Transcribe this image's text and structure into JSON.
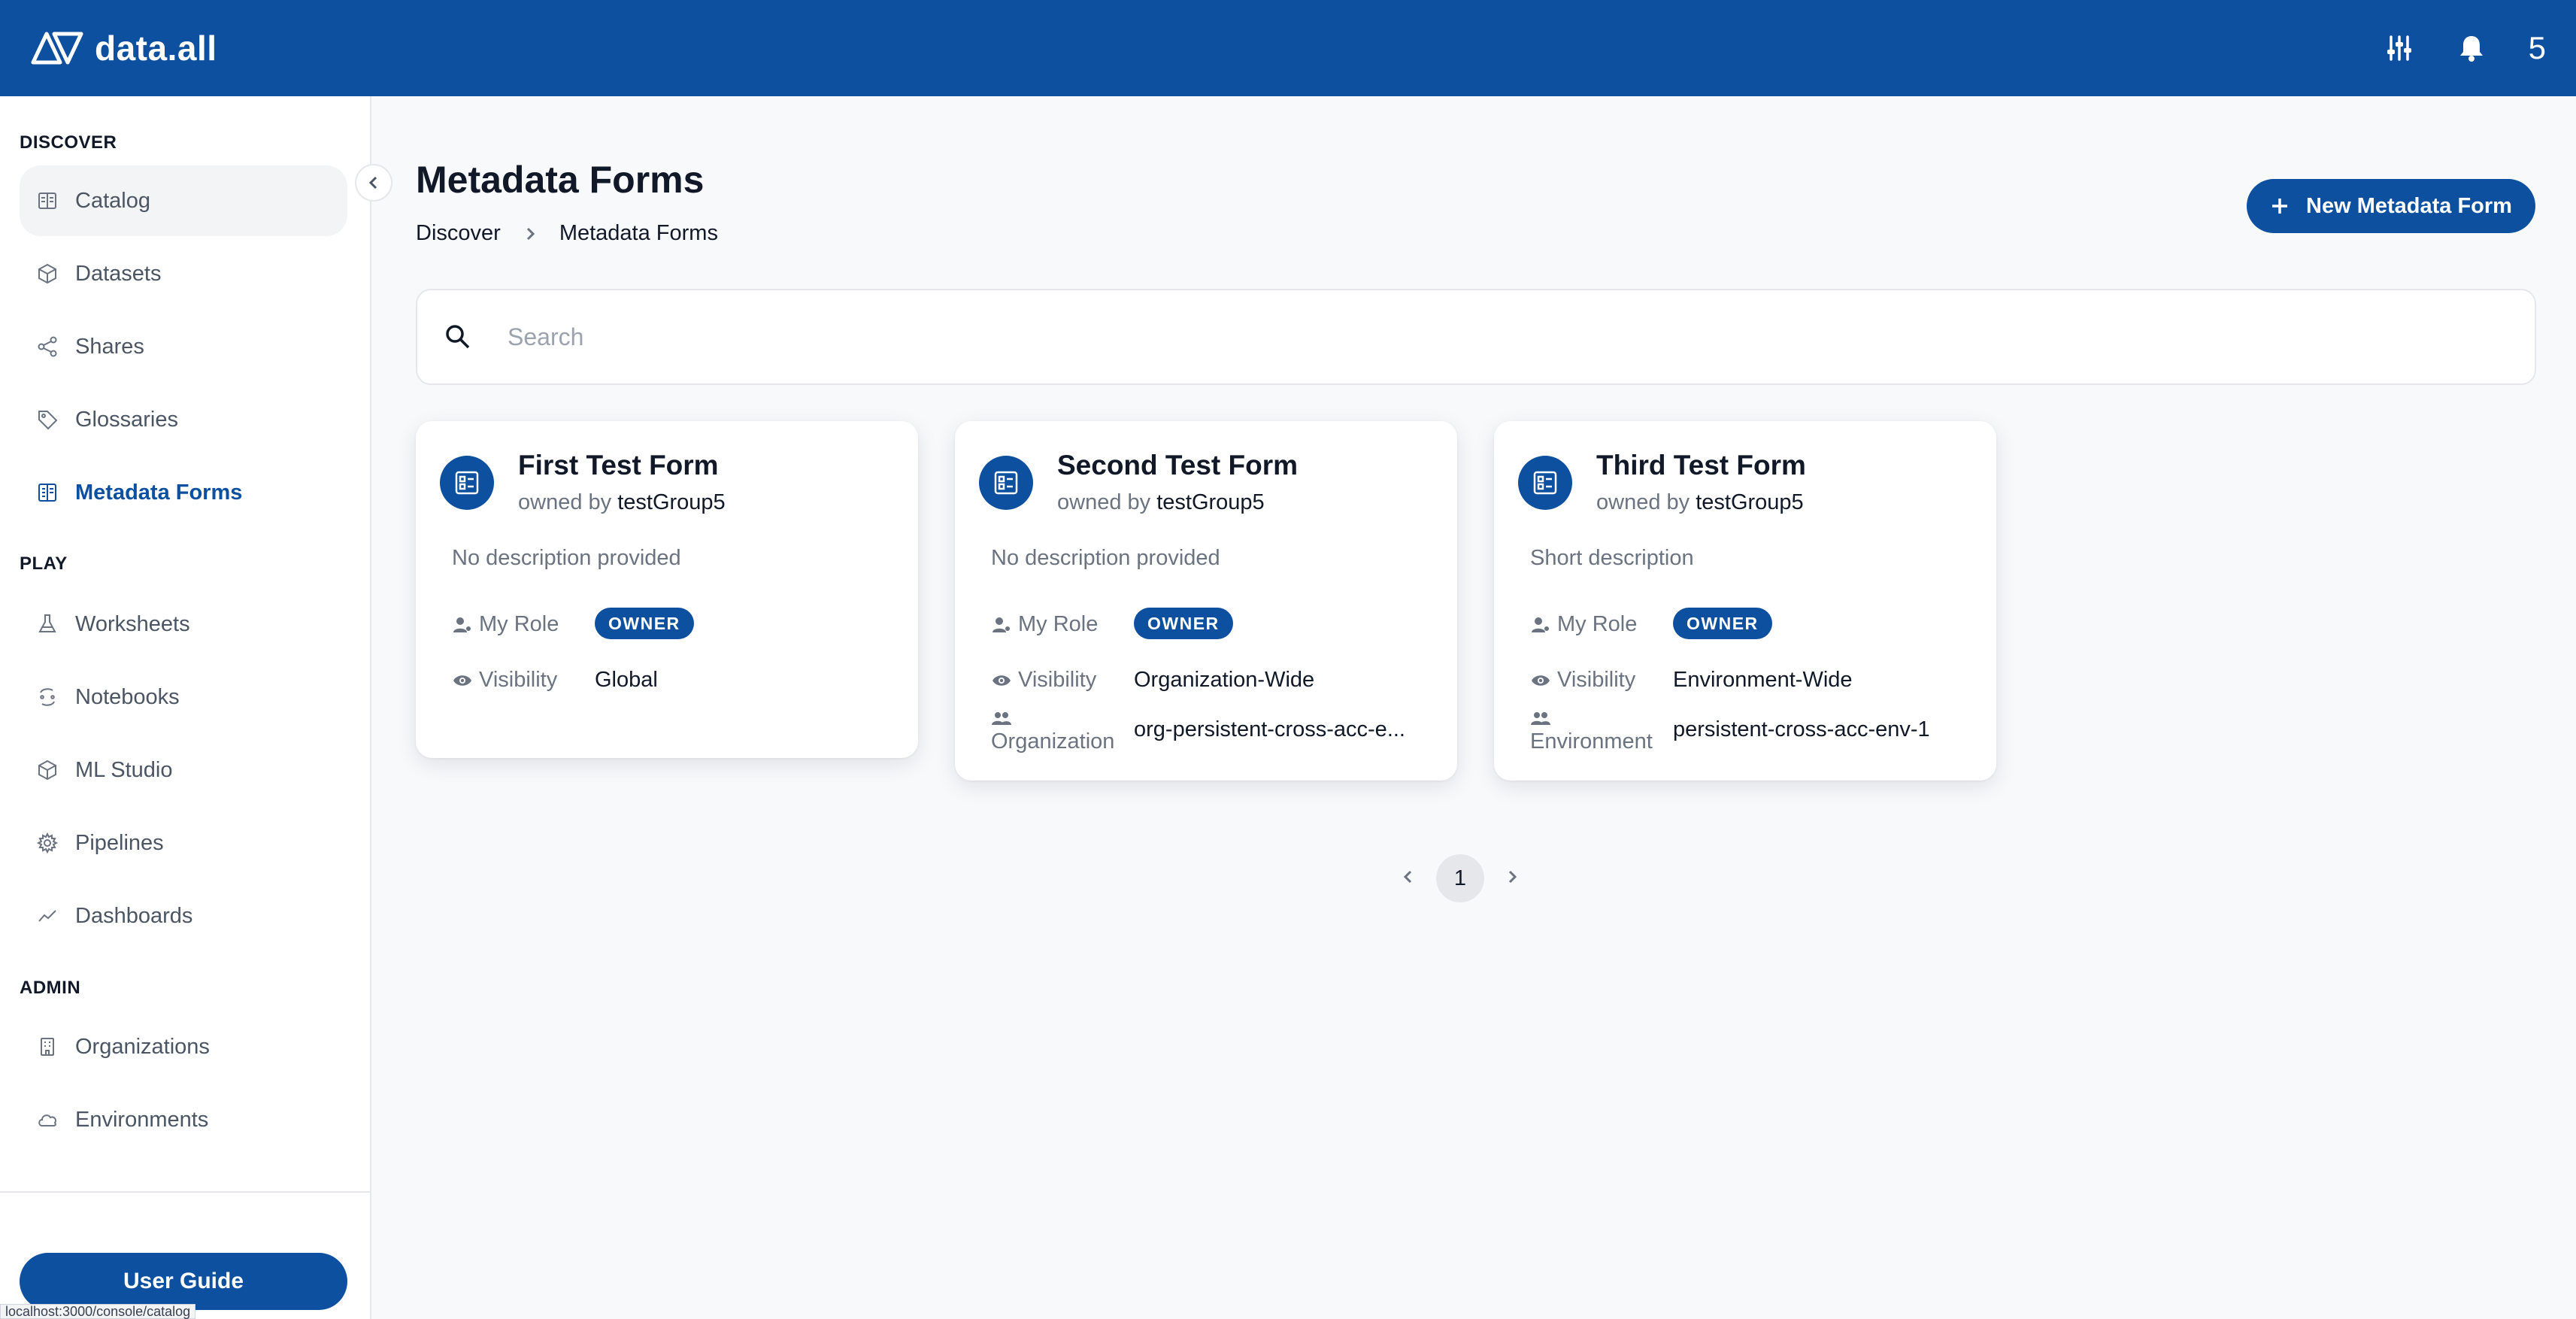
{
  "app": {
    "title": "data.all"
  },
  "header": {
    "user_count": "5"
  },
  "sidebar": {
    "sections": [
      {
        "title": "DISCOVER"
      },
      {
        "title": "PLAY"
      },
      {
        "title": "ADMIN"
      }
    ],
    "items": [
      {
        "label": "Catalog",
        "icon": "catalog-icon"
      },
      {
        "label": "Datasets",
        "icon": "cube-icon"
      },
      {
        "label": "Shares",
        "icon": "share-icon"
      },
      {
        "label": "Glossaries",
        "icon": "tag-icon"
      },
      {
        "label": "Metadata Forms",
        "icon": "form-icon",
        "active": true
      },
      {
        "label": "Worksheets",
        "icon": "flask-icon"
      },
      {
        "label": "Notebooks",
        "icon": "notebook-icon"
      },
      {
        "label": "ML Studio",
        "icon": "cube-icon"
      },
      {
        "label": "Pipelines",
        "icon": "gear-icon"
      },
      {
        "label": "Dashboards",
        "icon": "trend-icon"
      },
      {
        "label": "Organizations",
        "icon": "building-icon"
      },
      {
        "label": "Environments",
        "icon": "cloud-icon"
      }
    ],
    "user_guide_label": "User Guide",
    "status_url": "localhost:3000/console/catalog"
  },
  "main": {
    "title": "Metadata Forms",
    "breadcrumb": [
      "Discover",
      "Metadata Forms"
    ],
    "new_button_label": "New Metadata Form",
    "search_placeholder": "Search"
  },
  "cards": [
    {
      "title": "First Test Form",
      "owned_by_prefix": "owned by",
      "owner": "testGroup5",
      "description": "No description provided",
      "role_label": "My Role",
      "role": "OWNER",
      "visibility_label": "Visibility",
      "visibility": "Global"
    },
    {
      "title": "Second Test Form",
      "owned_by_prefix": "owned by",
      "owner": "testGroup5",
      "description": "No description provided",
      "role_label": "My Role",
      "role": "OWNER",
      "visibility_label": "Visibility",
      "visibility": "Organization-Wide",
      "scope_label": "Organization",
      "scope_value": "org-persistent-cross-acc-e..."
    },
    {
      "title": "Third Test Form",
      "owned_by_prefix": "owned by",
      "owner": "testGroup5",
      "description": "Short description",
      "role_label": "My Role",
      "role": "OWNER",
      "visibility_label": "Visibility",
      "visibility": "Environment-Wide",
      "scope_label": "Environment",
      "scope_value": "persistent-cross-acc-env-1"
    }
  ],
  "pagination": {
    "current_page": "1"
  },
  "colors": {
    "primary": "#0d50a0",
    "muted_text": "#6b7280",
    "background": "#f8f9fb"
  }
}
